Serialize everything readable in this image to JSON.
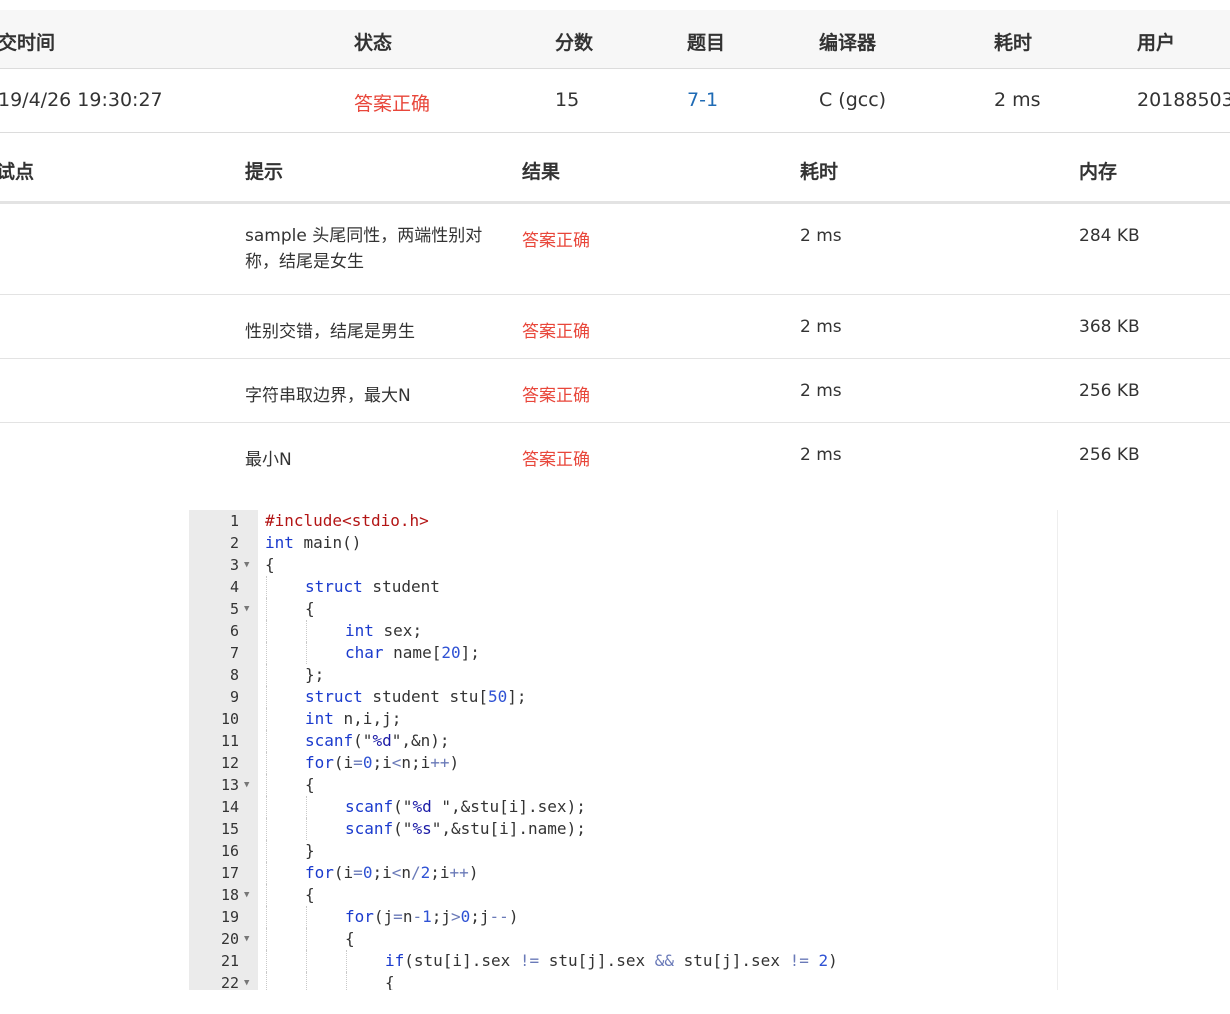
{
  "submission": {
    "headers": [
      "交时间",
      "状态",
      "分数",
      "题目",
      "编译器",
      "耗时",
      "用户"
    ],
    "row": {
      "time": "19/4/26 19:30:27",
      "status": "答案正确",
      "score": "15",
      "problem": "7-1",
      "compiler": "C (gcc)",
      "elapsed": "2 ms",
      "user": "20188503"
    }
  },
  "cases": {
    "headers": [
      "试点",
      "提示",
      "结果",
      "耗时",
      "内存"
    ],
    "rows": [
      {
        "hint": "sample 头尾同性，两端性别对称，结尾是女生",
        "result": "答案正确",
        "time": "2 ms",
        "memory": "284 KB"
      },
      {
        "hint": "性别交错，结尾是男生",
        "result": "答案正确",
        "time": "2 ms",
        "memory": "368 KB"
      },
      {
        "hint": "字符串取边界，最大N",
        "result": "答案正确",
        "time": "2 ms",
        "memory": "256 KB"
      },
      {
        "hint": "最小N",
        "result": "答案正确",
        "time": "2 ms",
        "memory": "256 KB"
      }
    ]
  },
  "code": {
    "lines": [
      {
        "n": "1",
        "fold": false,
        "indent": 0,
        "tokens": [
          [
            "inc",
            "#include<stdio.h>"
          ]
        ]
      },
      {
        "n": "2",
        "fold": false,
        "indent": 0,
        "tokens": [
          [
            "kw",
            "int"
          ],
          [
            "t",
            " main()"
          ]
        ]
      },
      {
        "n": "3",
        "fold": true,
        "indent": 0,
        "tokens": [
          [
            "t",
            "{"
          ]
        ]
      },
      {
        "n": "4",
        "fold": false,
        "indent": 1,
        "tokens": [
          [
            "kw",
            "struct"
          ],
          [
            "t",
            " student"
          ]
        ]
      },
      {
        "n": "5",
        "fold": true,
        "indent": 1,
        "tokens": [
          [
            "t",
            "{"
          ]
        ]
      },
      {
        "n": "6",
        "fold": false,
        "indent": 2,
        "tokens": [
          [
            "kw",
            "int"
          ],
          [
            "t",
            " sex;"
          ]
        ]
      },
      {
        "n": "7",
        "fold": false,
        "indent": 2,
        "tokens": [
          [
            "kw",
            "char"
          ],
          [
            "t",
            " name["
          ],
          [
            "num",
            "20"
          ],
          [
            "t",
            "];"
          ]
        ]
      },
      {
        "n": "8",
        "fold": false,
        "indent": 1,
        "tokens": [
          [
            "t",
            "};"
          ]
        ]
      },
      {
        "n": "9",
        "fold": false,
        "indent": 1,
        "tokens": [
          [
            "kw",
            "struct"
          ],
          [
            "t",
            " student stu["
          ],
          [
            "num",
            "50"
          ],
          [
            "t",
            "];"
          ]
        ]
      },
      {
        "n": "10",
        "fold": false,
        "indent": 1,
        "tokens": [
          [
            "kw",
            "int"
          ],
          [
            "t",
            " n,i,j;"
          ]
        ]
      },
      {
        "n": "11",
        "fold": false,
        "indent": 1,
        "tokens": [
          [
            "kw",
            "scanf"
          ],
          [
            "t",
            "(\""
          ],
          [
            "str",
            "%d"
          ],
          [
            "t",
            "\",&n);"
          ]
        ]
      },
      {
        "n": "12",
        "fold": false,
        "indent": 1,
        "tokens": [
          [
            "kw",
            "for"
          ],
          [
            "t",
            "(i"
          ],
          [
            "op",
            "="
          ],
          [
            "num",
            "0"
          ],
          [
            "t",
            ";i"
          ],
          [
            "op",
            "<"
          ],
          [
            "t",
            "n;i"
          ],
          [
            "op",
            "++"
          ],
          [
            "t",
            ")"
          ]
        ]
      },
      {
        "n": "13",
        "fold": true,
        "indent": 1,
        "tokens": [
          [
            "t",
            "{"
          ]
        ]
      },
      {
        "n": "14",
        "fold": false,
        "indent": 2,
        "tokens": [
          [
            "kw",
            "scanf"
          ],
          [
            "t",
            "(\""
          ],
          [
            "str",
            "%d"
          ],
          [
            "t",
            " \",&stu[i].sex);"
          ]
        ]
      },
      {
        "n": "15",
        "fold": false,
        "indent": 2,
        "tokens": [
          [
            "kw",
            "scanf"
          ],
          [
            "t",
            "(\""
          ],
          [
            "str",
            "%s"
          ],
          [
            "t",
            "\",&stu[i].name);"
          ]
        ]
      },
      {
        "n": "16",
        "fold": false,
        "indent": 1,
        "tokens": [
          [
            "t",
            "}"
          ]
        ]
      },
      {
        "n": "17",
        "fold": false,
        "indent": 1,
        "tokens": [
          [
            "kw",
            "for"
          ],
          [
            "t",
            "(i"
          ],
          [
            "op",
            "="
          ],
          [
            "num",
            "0"
          ],
          [
            "t",
            ";i"
          ],
          [
            "op",
            "<"
          ],
          [
            "t",
            "n"
          ],
          [
            "op",
            "/"
          ],
          [
            "num",
            "2"
          ],
          [
            "t",
            ";i"
          ],
          [
            "op",
            "++"
          ],
          [
            "t",
            ")"
          ]
        ]
      },
      {
        "n": "18",
        "fold": true,
        "indent": 1,
        "tokens": [
          [
            "t",
            "{"
          ]
        ]
      },
      {
        "n": "19",
        "fold": false,
        "indent": 2,
        "tokens": [
          [
            "kw",
            "for"
          ],
          [
            "t",
            "(j"
          ],
          [
            "op",
            "="
          ],
          [
            "t",
            "n"
          ],
          [
            "op",
            "-"
          ],
          [
            "num",
            "1"
          ],
          [
            "t",
            ";j"
          ],
          [
            "op",
            ">"
          ],
          [
            "num",
            "0"
          ],
          [
            "t",
            ";j"
          ],
          [
            "op",
            "--"
          ],
          [
            "t",
            ")"
          ]
        ]
      },
      {
        "n": "20",
        "fold": true,
        "indent": 2,
        "tokens": [
          [
            "t",
            "{"
          ]
        ]
      },
      {
        "n": "21",
        "fold": false,
        "indent": 3,
        "tokens": [
          [
            "kw",
            "if"
          ],
          [
            "t",
            "(stu[i].sex "
          ],
          [
            "op",
            "!="
          ],
          [
            "t",
            " stu[j].sex "
          ],
          [
            "op",
            "&&"
          ],
          [
            "t",
            " stu[j].sex "
          ],
          [
            "op",
            "!="
          ],
          [
            "t",
            " "
          ],
          [
            "num",
            "2"
          ],
          [
            "t",
            ")"
          ]
        ]
      },
      {
        "n": "22",
        "fold": true,
        "indent": 3,
        "tokens": [
          [
            "t",
            "{"
          ]
        ]
      }
    ]
  }
}
